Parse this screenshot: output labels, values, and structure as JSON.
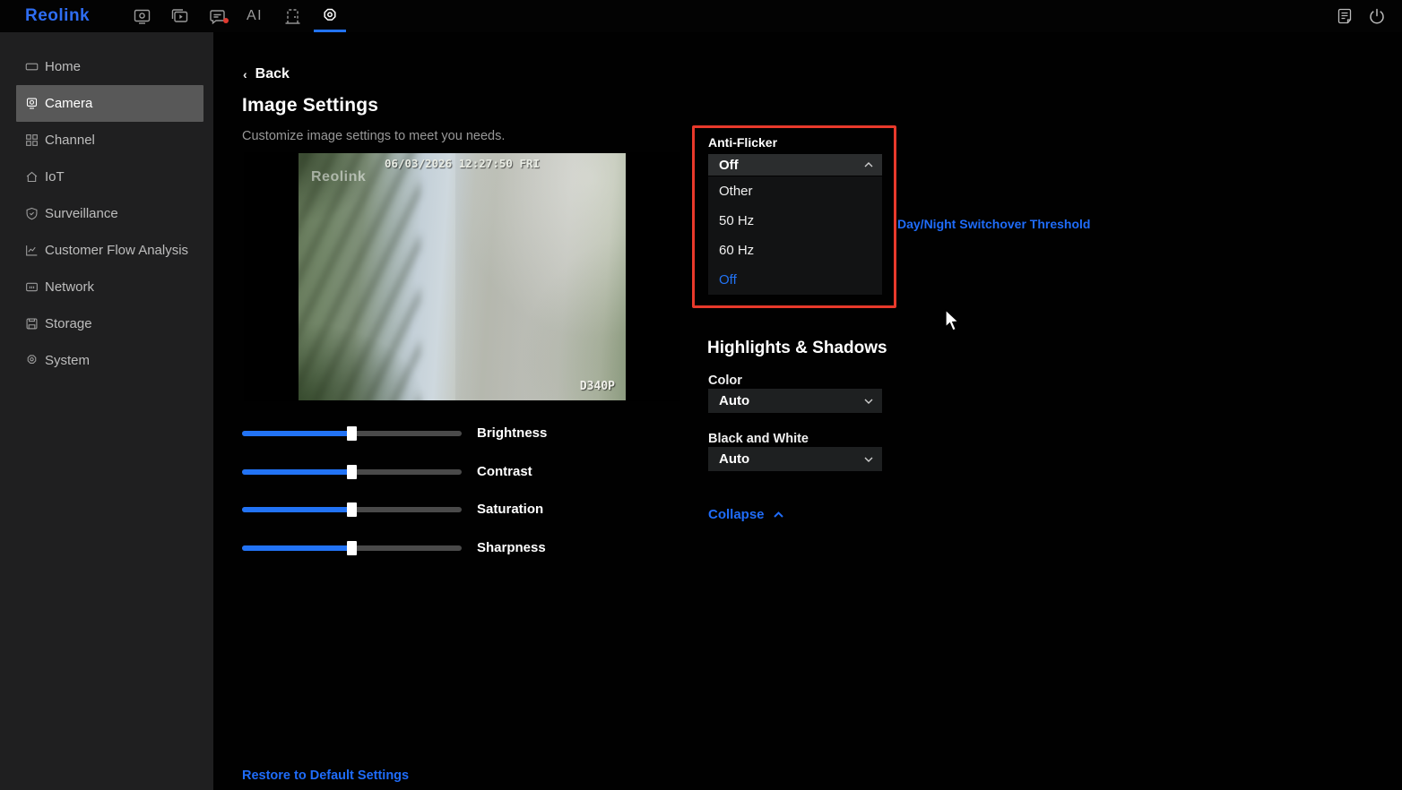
{
  "topbar": {
    "logo": "Reolink",
    "nav_icons": [
      {
        "name": "display-icon"
      },
      {
        "name": "playback-icon"
      },
      {
        "name": "messages-icon",
        "badge": true
      },
      {
        "name": "ai-icon",
        "text": "AI"
      },
      {
        "name": "door-icon"
      },
      {
        "name": "settings-icon",
        "active": true
      }
    ],
    "right_icons": [
      {
        "name": "log-icon"
      },
      {
        "name": "power-icon"
      }
    ]
  },
  "sidebar": {
    "items": [
      {
        "label": "Home",
        "icon": "home-icon",
        "active": false
      },
      {
        "label": "Camera",
        "icon": "camera-icon",
        "active": true
      },
      {
        "label": "Channel",
        "icon": "channel-icon",
        "active": false
      },
      {
        "label": "IoT",
        "icon": "iot-icon",
        "active": false
      },
      {
        "label": "Surveillance",
        "icon": "surveillance-icon",
        "active": false
      },
      {
        "label": "Customer Flow Analysis",
        "icon": "flow-icon",
        "active": false
      },
      {
        "label": "Network",
        "icon": "network-icon",
        "active": false
      },
      {
        "label": "Storage",
        "icon": "storage-icon",
        "active": false
      },
      {
        "label": "System",
        "icon": "system-icon",
        "active": false
      }
    ]
  },
  "main": {
    "back_label": "Back",
    "title": "Image Settings",
    "subtitle": "Customize image settings to meet you needs.",
    "preview": {
      "watermark": "Reolink",
      "timestamp": "06/03/2026 12:27:50 FRI",
      "model": "D340P"
    },
    "sliders": [
      {
        "label": "Brightness",
        "value": 50
      },
      {
        "label": "Contrast",
        "value": 50
      },
      {
        "label": "Saturation",
        "value": 50
      },
      {
        "label": "Sharpness",
        "value": 50
      }
    ],
    "anti_flicker": {
      "label": "Anti-Flicker",
      "value": "Off",
      "options": [
        {
          "label": "Other",
          "selected": false
        },
        {
          "label": "50 Hz",
          "selected": false
        },
        {
          "label": "60 Hz",
          "selected": false
        },
        {
          "label": "Off",
          "selected": true
        }
      ]
    },
    "day_night_link": "Day/Night Switchover Threshold",
    "highlights": {
      "title": "Highlights & Shadows",
      "color_label": "Color",
      "color_value": "Auto",
      "bw_label": "Black and White",
      "bw_value": "Auto"
    },
    "collapse_label": "Collapse",
    "restore_label": "Restore to Default Settings"
  },
  "colors": {
    "accent": "#2273f5",
    "link_blue": "#1f6cf9",
    "highlight_red": "#e8392b"
  }
}
